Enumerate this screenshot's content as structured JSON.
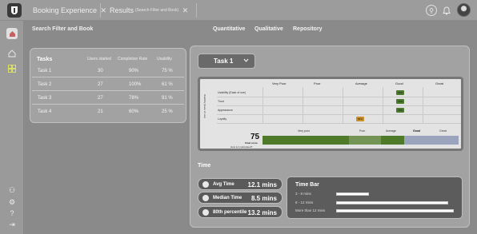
{
  "tabs": [
    {
      "label": "Booking Experience",
      "sub": ""
    },
    {
      "label": "Results",
      "sub": "(Search Filter and Book)"
    }
  ],
  "page_title": "Search Filter and Book",
  "view_tabs": [
    "Quantitative",
    "Qualitative",
    "Repository"
  ],
  "tasks_table": {
    "title": "Tasks",
    "columns": [
      "Users started",
      "Completion Rate",
      "Usability"
    ],
    "rows": [
      {
        "name": "Task 1",
        "users": "30",
        "completion": "90%",
        "usability": "75 %"
      },
      {
        "name": "Task 2",
        "users": "27",
        "completion": "100%",
        "usability": "61 %"
      },
      {
        "name": "Task 3",
        "users": "27",
        "completion": "78%",
        "usability": "91 %"
      },
      {
        "name": "Task 4",
        "users": "21",
        "completion": "60%",
        "usability": "25 %"
      }
    ]
  },
  "task_selector": {
    "value": "Task 1"
  },
  "matrix": {
    "side_label": "Usability (Ease of use)",
    "columns": [
      "Very Poor",
      "Poor",
      "Average",
      "Good",
      "Great"
    ],
    "rows": [
      {
        "label": "Usability (Ease of use)",
        "badge": "76%",
        "badge_col": 3,
        "badge_color": "#4c7a2f"
      },
      {
        "label": "Trust",
        "badge": "76%",
        "badge_col": 3,
        "badge_color": "#4c7a2f"
      },
      {
        "label": "Appearance",
        "badge": "76%",
        "badge_col": 3,
        "badge_color": "#4c7a2f"
      },
      {
        "label": "Loyalty",
        "badge": "55%",
        "badge_col": 2,
        "badge_color": "#c8902a"
      }
    ],
    "score": "75",
    "score_caption": "Final score",
    "score_link": "How is it calculated?",
    "scale_labels": [
      "Very poor",
      "Poor",
      "Average",
      "Good",
      "Great"
    ],
    "colors": {
      "green": "#4f7a2a",
      "gray": "#b6b6b6",
      "blue": "#9aa5bd"
    }
  },
  "time": {
    "title": "Time",
    "stats": [
      {
        "label": "Avg Time",
        "value": "12.1 mins"
      },
      {
        "label": "Median Time",
        "value": "8.5 mins"
      },
      {
        "label": "80th percentile",
        "value": "13.2 mins"
      }
    ],
    "bar_panel": {
      "title": "Time Bar",
      "rows": [
        {
          "label": "3 - 8 mins",
          "fraction": 0.27
        },
        {
          "label": "8 - 12 mins",
          "fraction": 0.93
        },
        {
          "label": "More than 12 mins",
          "fraction": 0.98
        }
      ]
    }
  }
}
